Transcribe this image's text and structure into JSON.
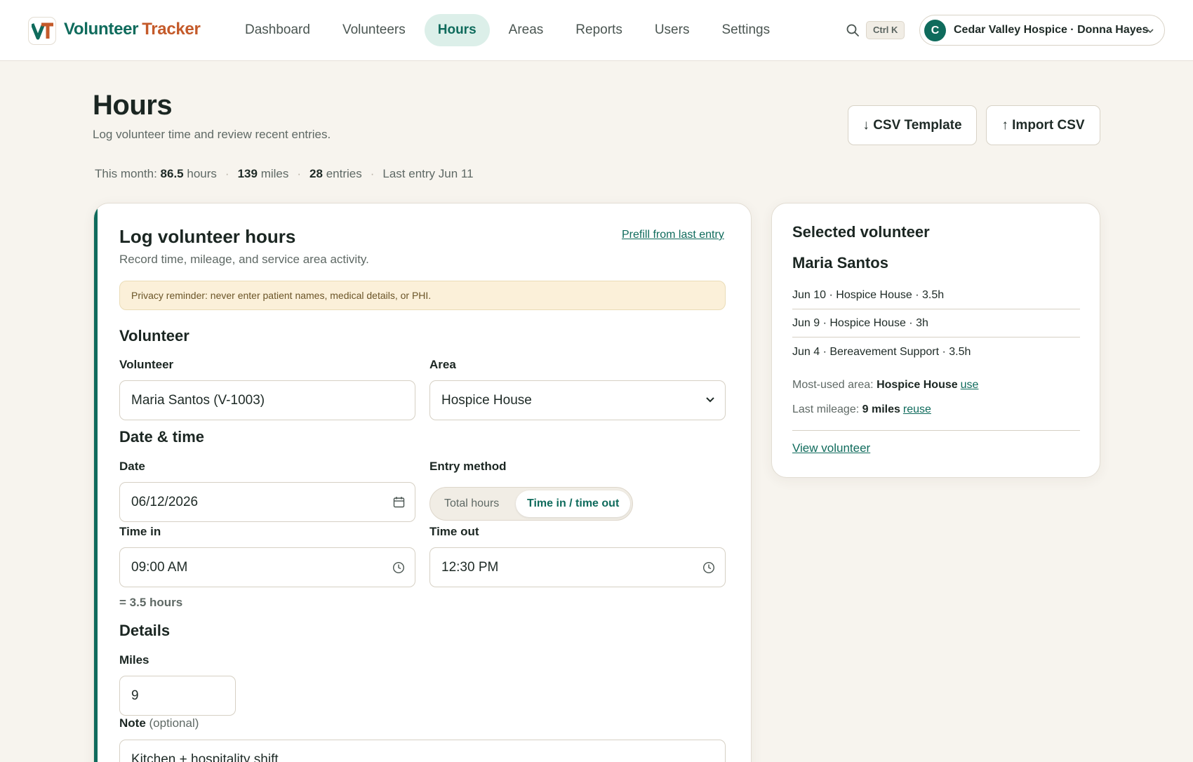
{
  "brand": {
    "part1": "Volunteer",
    "part2": "Tracker"
  },
  "nav": [
    {
      "label": "Dashboard"
    },
    {
      "label": "Volunteers"
    },
    {
      "label": "Hours"
    },
    {
      "label": "Areas"
    },
    {
      "label": "Reports"
    },
    {
      "label": "Users"
    },
    {
      "label": "Settings"
    }
  ],
  "active_nav": "Hours",
  "shortcut": "Ctrl K",
  "org": {
    "initial": "C",
    "label": "Cedar Valley Hospice · Donna Hayes"
  },
  "page": {
    "title": "Hours",
    "subtitle": "Log volunteer time and review recent entries.",
    "csv_template": "↓ CSV Template",
    "import_csv": "↑ Import CSV"
  },
  "stats": {
    "month_prefix": "This month:",
    "hours_value": "86.5",
    "hours_unit": "hours",
    "miles_value": "139",
    "miles_unit": "miles",
    "entries_value": "28",
    "entries_unit": "entries",
    "last_entry": "Last entry Jun 11"
  },
  "form": {
    "title": "Log volunteer hours",
    "subtitle": "Record time, mileage, and service area activity.",
    "prefill": "Prefill from last entry",
    "privacy": "Privacy reminder: never enter patient names, medical details, or PHI.",
    "section_volunteer": "Volunteer",
    "volunteer_label": "Volunteer",
    "volunteer_value": "Maria Santos (V-1003)",
    "area_label": "Area",
    "area_value": "Hospice House",
    "section_datetime": "Date & time",
    "date_label": "Date",
    "date_value": "06/12/2026",
    "entry_method_label": "Entry method",
    "method_total": "Total hours",
    "method_inout": "Time in / time out",
    "time_in_label": "Time in",
    "time_in_value": "09:00 AM",
    "time_out_label": "Time out",
    "time_out_value": "12:30 PM",
    "computed": "= 3.5 hours",
    "section_details": "Details",
    "miles_label": "Miles",
    "miles_value": "9",
    "note_label": "Note",
    "note_optional": "(optional)",
    "note_value": "Kitchen + hospitality shift"
  },
  "selected": {
    "heading": "Selected volunteer",
    "name": "Maria Santos",
    "recent": [
      "Jun 10 · Hospice House · 3.5h",
      "Jun 9 · Hospice House · 3h",
      "Jun 4 · Bereavement Support · 3.5h"
    ],
    "most_used_prefix": "Most-used area:",
    "most_used_value": "Hospice House",
    "most_used_link": "use",
    "last_mileage_prefix": "Last mileage:",
    "last_mileage_value": "9 miles",
    "last_mileage_link": "reuse",
    "view_link": "View volunteer"
  },
  "colors": {
    "accent": "#0f6b5c",
    "brand_orange": "#c45a2a",
    "background": "#f7f4ee"
  }
}
